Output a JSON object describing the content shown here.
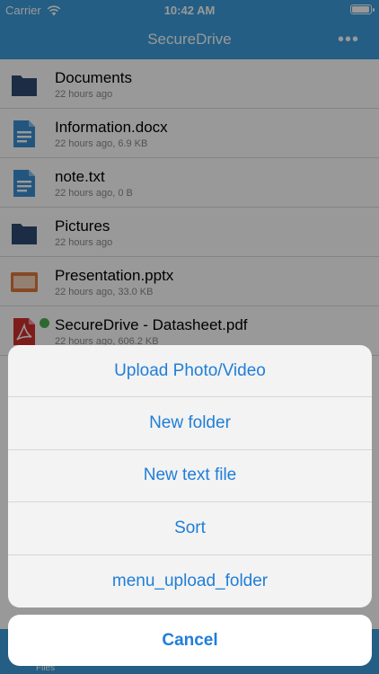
{
  "status_bar": {
    "carrier": "Carrier",
    "time": "10:42 AM"
  },
  "nav": {
    "title": "SecureDrive",
    "more_icon": "more-horizontal-icon"
  },
  "files": [
    {
      "name": "Documents",
      "meta": "22 hours ago",
      "icon": "folder-icon"
    },
    {
      "name": "Information.docx",
      "meta": "22 hours ago, 6.9 KB",
      "icon": "document-icon"
    },
    {
      "name": "note.txt",
      "meta": "22 hours ago, 0 B",
      "icon": "document-icon"
    },
    {
      "name": "Pictures",
      "meta": "22 hours ago",
      "icon": "folder-icon"
    },
    {
      "name": "Presentation.pptx",
      "meta": "22 hours ago, 33.0 KB",
      "icon": "presentation-icon"
    },
    {
      "name": "SecureDrive - Datasheet.pdf",
      "meta": "22 hours ago, 606.2 KB",
      "icon": "pdf-icon",
      "synced": true
    }
  ],
  "tab_bar": {
    "files_label": "Files"
  },
  "action_sheet": {
    "items": [
      "Upload Photo/Video",
      "New folder",
      "New text file",
      "Sort",
      "menu_upload_folder"
    ],
    "cancel": "Cancel"
  },
  "colors": {
    "brand": "#3d9ddc",
    "action_text": "#1f7ed8",
    "folder": "#2f4a73",
    "doc": "#3b8fd4",
    "pptx": "#e07b3c",
    "pdf": "#d32f2f",
    "synced": "#4caf50"
  }
}
